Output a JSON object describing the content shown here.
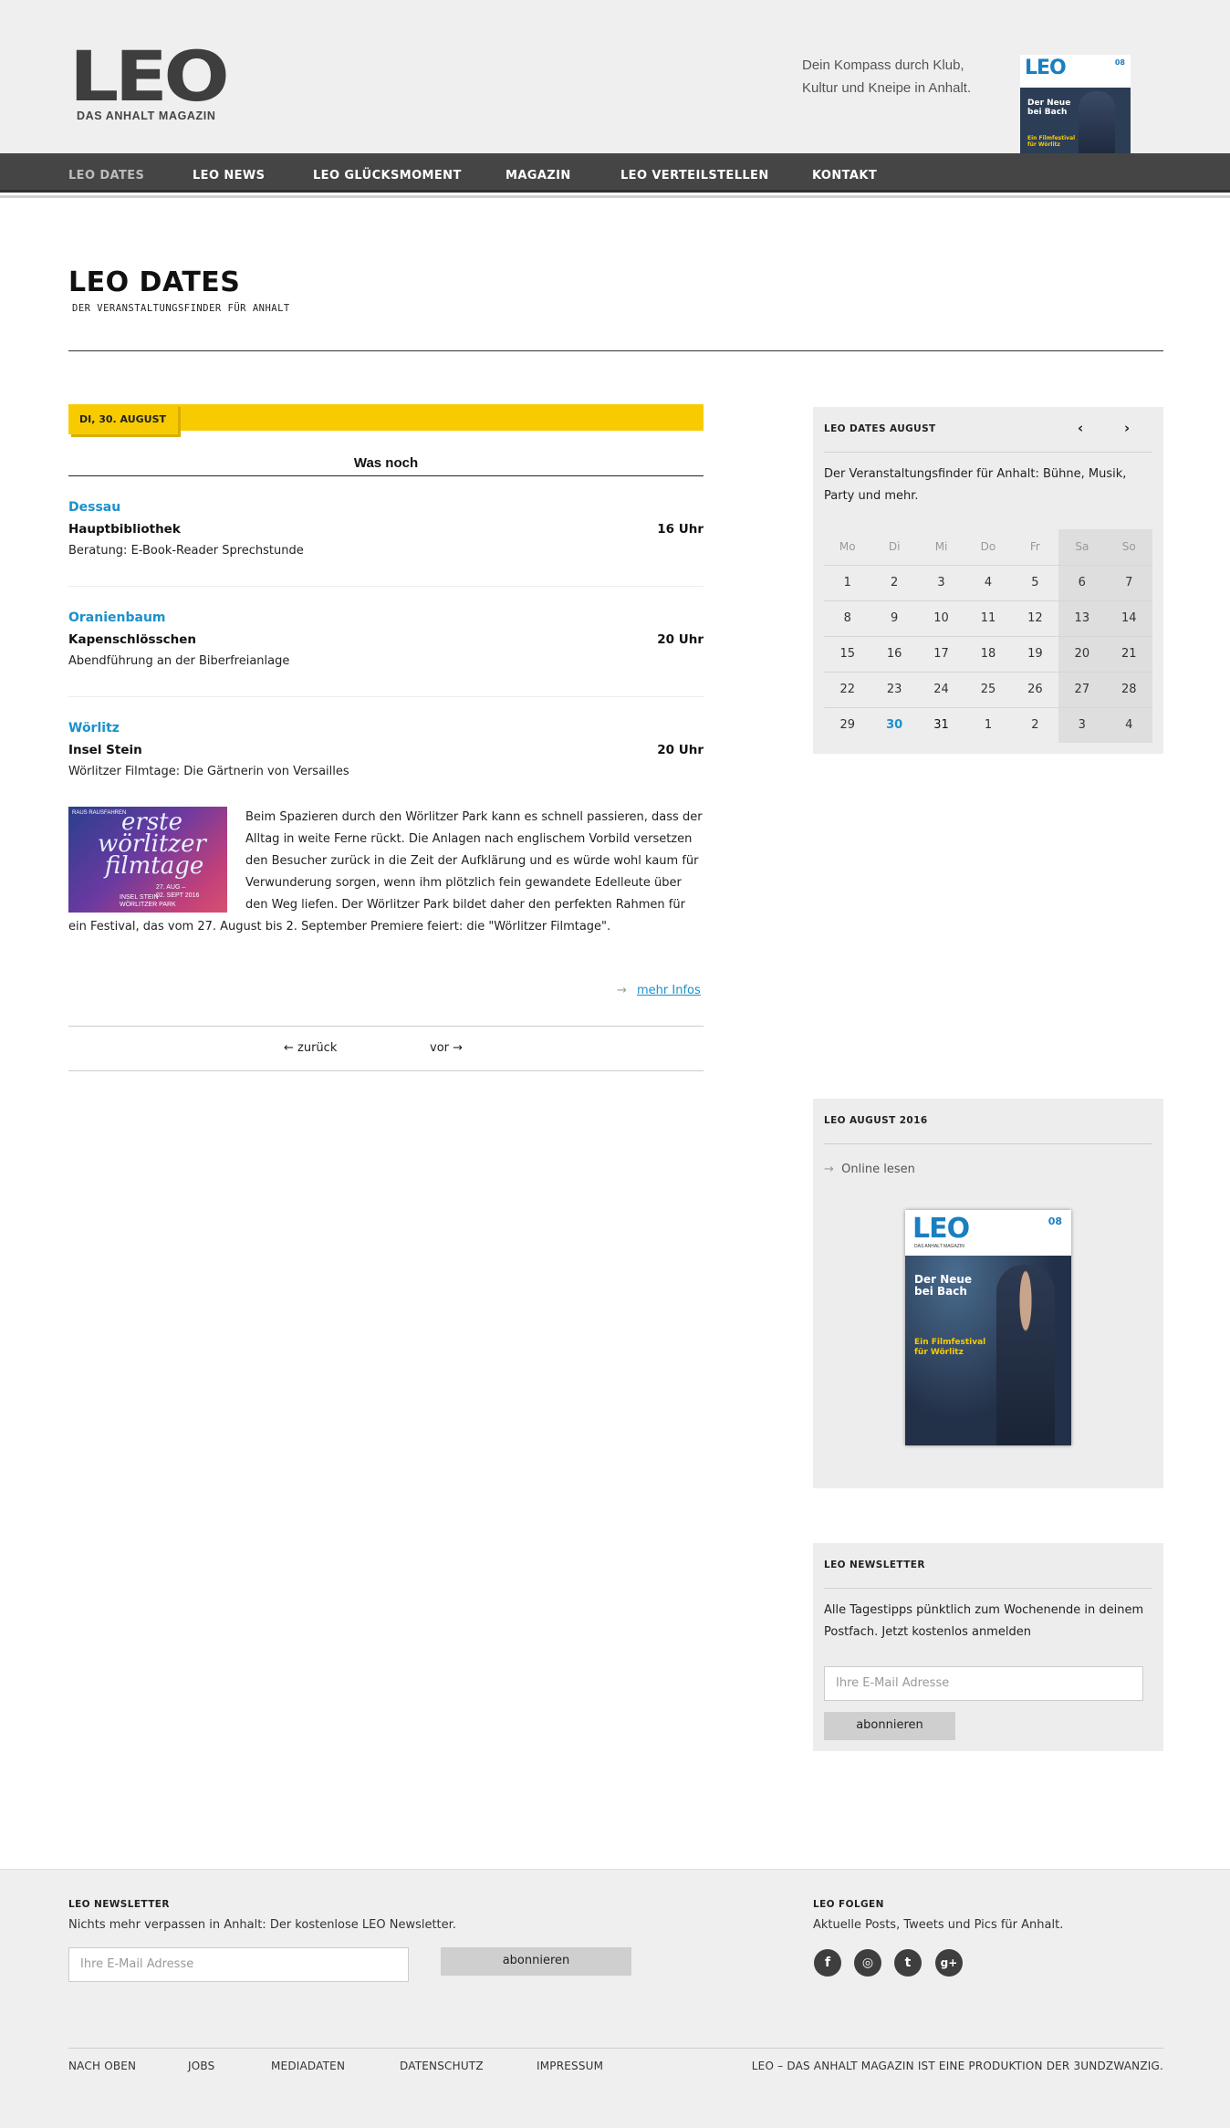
{
  "header": {
    "logo_text": "LEO",
    "logo_sub": "DAS ANHALT MAGAZIN",
    "tagline_1": "Dein Kompass durch Klub,",
    "tagline_2": "Kultur und Kneipe in Anhalt."
  },
  "nav": [
    {
      "label": "LEO DATES",
      "active": true
    },
    {
      "label": "LEO NEWS"
    },
    {
      "label": "LEO GLÜCKSMOMENT"
    },
    {
      "label": "MAGAZIN"
    },
    {
      "label": "LEO VERTEILSTELLEN"
    },
    {
      "label": "KONTAKT"
    }
  ],
  "page": {
    "title": "LEO DATES",
    "subtitle": "DER VERANSTALTUNGSFINDER FÜR ANHALT"
  },
  "date_tag": "DI, 30. AUGUST",
  "section_head": "Was noch",
  "events": [
    {
      "city": "Dessau",
      "venue": "Hauptbibliothek",
      "time": "16 Uhr",
      "desc": "Beratung: E-Book-Reader Sprechstunde"
    },
    {
      "city": "Oranienbaum",
      "venue": "Kapenschlösschen",
      "time": "20 Uhr",
      "desc": "Abendführung an der Biberfreianlage"
    },
    {
      "city": "Wörlitz",
      "venue": "Insel Stein",
      "time": "20 Uhr",
      "desc": "Wörlitzer Filmtage: Die Gärtnerin von Versailles"
    }
  ],
  "event_image": {
    "line1": "erste",
    "line2": "wörlitzer",
    "line3": "filmtage",
    "dates_1": "27. AUG –",
    "dates_2": "02. SEPT 2016",
    "place_1": "INSEL STEIN",
    "place_2": "WÖRLITZER PARK",
    "corner": "RAUS RAUSFAHREN"
  },
  "event_text": "Beim Spazieren durch den Wörlitzer Park kann es schnell passieren, dass der Alltag in weite Ferne rückt. Die Anlagen nach englischem Vorbild versetzen den Besucher zurück in die Zeit der Aufklärung und es würde wohl kaum für Verwunderung sorgen, wenn ihm plötzlich fein gewandete Edelleute über den Weg liefen. Der Wörlitzer Park bildet daher den perfekten Rahmen für ein Festival, das vom 27. August bis 2. September Premiere feiert: die \"Wörlitzer Filmtage\".",
  "more_link": "mehr Infos",
  "pager": {
    "prev": "← zurück",
    "next": "vor →"
  },
  "calendar": {
    "title": "LEO DATES AUGUST",
    "prev_icon": "‹",
    "next_icon": "›",
    "intro": "Der Veranstaltungsfinder für Anhalt: Bühne, Musik, Party und mehr.",
    "weekdays": [
      "Mo",
      "Di",
      "Mi",
      "Do",
      "Fr",
      "Sa",
      "So"
    ],
    "weeks": [
      [
        "1",
        "2",
        "3",
        "4",
        "5",
        "6",
        "7"
      ],
      [
        "8",
        "9",
        "10",
        "11",
        "12",
        "13",
        "14"
      ],
      [
        "15",
        "16",
        "17",
        "18",
        "19",
        "20",
        "21"
      ],
      [
        "22",
        "23",
        "24",
        "25",
        "26",
        "27",
        "28"
      ],
      [
        "29",
        "30",
        "31",
        "1",
        "2",
        "3",
        "4"
      ]
    ],
    "today": "30"
  },
  "magazine": {
    "title": "LEO AUGUST 2016",
    "online": "Online lesen",
    "cover_logo": "LEO",
    "cover_sub": "DAS ANHALT MAGAZIN",
    "cover_num": "08",
    "cover_headline_1": "Der Neue",
    "cover_headline_2": "bei Bach",
    "cover_sub_1": "Ein Filmfestival",
    "cover_sub_2": "für Wörlitz"
  },
  "newsletter_side": {
    "title": "LEO NEWSLETTER",
    "text": "Alle Tagestipps pünktlich zum Wochenende in deinem Postfach. Jetzt kostenlos anmelden",
    "placeholder": "Ihre E-Mail Adresse",
    "button": "abonnieren"
  },
  "footer": {
    "nl_title": "LEO NEWSLETTER",
    "nl_text": "Nichts mehr verpassen in Anhalt: Der kostenlose LEO Newsletter.",
    "nl_placeholder": "Ihre E-Mail Adresse",
    "nl_button": "abonnieren",
    "follow_title": "LEO FOLGEN",
    "follow_text": "Aktuelle Posts, Tweets und Pics für Anhalt.",
    "social": [
      "f",
      "◎",
      "t",
      "g+"
    ],
    "links": [
      "NACH OBEN",
      "JOBS",
      "MEDIADATEN",
      "DATENSCHUTZ",
      "IMPRESSUM"
    ],
    "credit": "LEO – DAS ANHALT MAGAZIN IST EINE PRODUKTION DER 3UNDZWANZIG."
  },
  "colors": {
    "accent": "#1a91cc",
    "datebar": "#f8cb00",
    "nav": "#454545"
  }
}
